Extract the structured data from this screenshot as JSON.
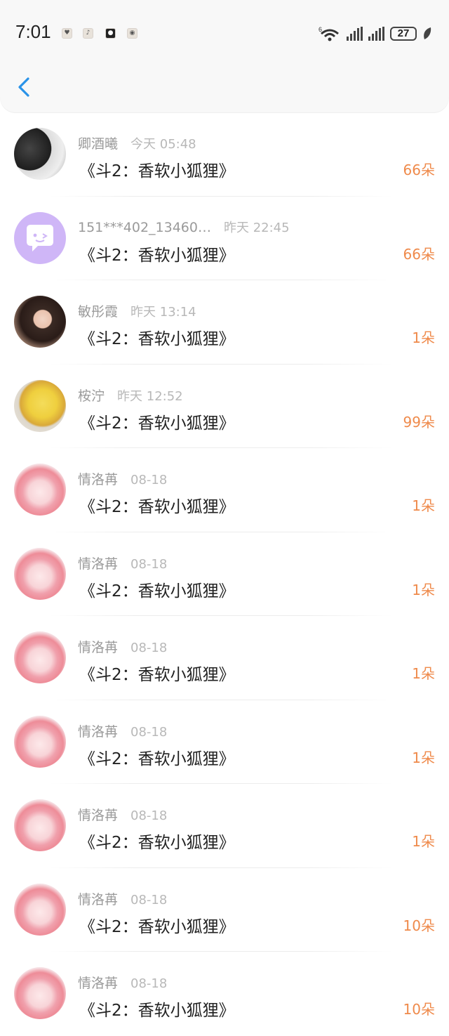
{
  "status_bar": {
    "time": "7:01",
    "battery": "27",
    "notification_icons": [
      "app-icon-1",
      "app-icon-2",
      "app-icon-3",
      "app-icon-4"
    ],
    "network_label": "6"
  },
  "header": {
    "back_icon": "chevron-left-icon"
  },
  "colors": {
    "accent": "#2a93e8",
    "amount": "#ef8a4b"
  },
  "items": [
    {
      "name": "卿酒曦",
      "time": "今天 05:48",
      "title": "《斗2：香软小狐狸》",
      "amount": "66朵",
      "avatar": "dark-photo-avatar"
    },
    {
      "name": "151***402_13460…",
      "time": "昨天 22:45",
      "title": "《斗2：香软小狐狸》",
      "amount": "66朵",
      "avatar": "default-chat-avatar"
    },
    {
      "name": "敏彤霞",
      "time": "昨天 13:14",
      "title": "《斗2：香软小狐狸》",
      "amount": "1朵",
      "avatar": "girl-photo-avatar"
    },
    {
      "name": "桉泞",
      "time": "昨天 12:52",
      "title": "《斗2：香软小狐狸》",
      "amount": "99朵",
      "avatar": "chick-avatar"
    },
    {
      "name": "情洛苒",
      "time": "08-18",
      "title": "《斗2：香软小狐狸》",
      "amount": "1朵",
      "avatar": "anime-girl-avatar"
    },
    {
      "name": "情洛苒",
      "time": "08-18",
      "title": "《斗2：香软小狐狸》",
      "amount": "1朵",
      "avatar": "anime-girl-avatar"
    },
    {
      "name": "情洛苒",
      "time": "08-18",
      "title": "《斗2：香软小狐狸》",
      "amount": "1朵",
      "avatar": "anime-girl-avatar"
    },
    {
      "name": "情洛苒",
      "time": "08-18",
      "title": "《斗2：香软小狐狸》",
      "amount": "1朵",
      "avatar": "anime-girl-avatar"
    },
    {
      "name": "情洛苒",
      "time": "08-18",
      "title": "《斗2：香软小狐狸》",
      "amount": "1朵",
      "avatar": "anime-girl-avatar"
    },
    {
      "name": "情洛苒",
      "time": "08-18",
      "title": "《斗2：香软小狐狸》",
      "amount": "10朵",
      "avatar": "anime-girl-avatar"
    },
    {
      "name": "情洛苒",
      "time": "08-18",
      "title": "《斗2：香软小狐狸》",
      "amount": "10朵",
      "avatar": "anime-girl-avatar"
    }
  ]
}
